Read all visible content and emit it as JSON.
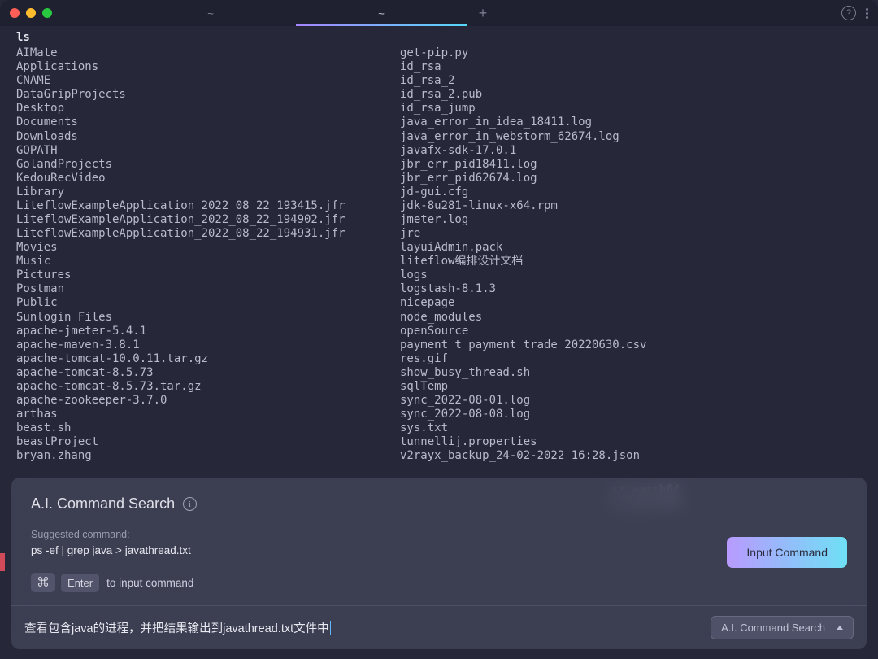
{
  "titlebar": {
    "tab1_label": "~",
    "tab2_label": "~",
    "add_label": "+"
  },
  "terminal": {
    "command": "ls",
    "files_col1": [
      "AIMate",
      "Applications",
      "CNAME",
      "DataGripProjects",
      "Desktop",
      "Documents",
      "Downloads",
      "GOPATH",
      "GolandProjects",
      "KedouRecVideo",
      "Library",
      "LiteflowExampleApplication_2022_08_22_193415.jfr",
      "LiteflowExampleApplication_2022_08_22_194902.jfr",
      "LiteflowExampleApplication_2022_08_22_194931.jfr",
      "Movies",
      "Music",
      "Pictures",
      "Postman",
      "Public",
      "Sunlogin Files",
      "apache-jmeter-5.4.1",
      "apache-maven-3.8.1",
      "apache-tomcat-10.0.11.tar.gz",
      "apache-tomcat-8.5.73",
      "apache-tomcat-8.5.73.tar.gz",
      "apache-zookeeper-3.7.0",
      "arthas",
      "beast.sh",
      "beastProject",
      "bryan.zhang"
    ],
    "files_col2": [
      "get-pip.py",
      "id_rsa",
      "id_rsa_2",
      "id_rsa_2.pub",
      "id_rsa_jump",
      "java_error_in_idea_18411.log",
      "java_error_in_webstorm_62674.log",
      "javafx-sdk-17.0.1",
      "jbr_err_pid18411.log",
      "jbr_err_pid62674.log",
      "jd-gui.cfg",
      "jdk-8u281-linux-x64.rpm",
      "jmeter.log",
      "jre",
      "layuiAdmin.pack",
      "liteflow编排设计文档",
      "logs",
      "logstash-8.1.3",
      "nicepage",
      "node_modules",
      "openSource",
      "payment_t_payment_trade_20220630.csv",
      "res.gif",
      "show_busy_thread.sh",
      "sqlTemp",
      "sync_2022-08-01.log",
      "sync_2022-08-08.log",
      "sys.txt",
      "tunnellij.properties",
      "v2rayx_backup_24-02-2022 16:28.json"
    ],
    "extra_visible": [
      "sx_aarch64",
      "sx_aarch64"
    ]
  },
  "ai_panel": {
    "title": "A.I. Command Search",
    "suggested_label": "Suggested command:",
    "suggested_command": "ps -ef | grep java > javathread.txt",
    "key_cmd": "⌘",
    "key_enter": "Enter",
    "hint_text": "to input command",
    "button_label": "Input Command",
    "search_text": "查看包含java的进程，并把结果输出到javathread.txt文件中",
    "dropdown_label": "A.I. Command Search"
  }
}
